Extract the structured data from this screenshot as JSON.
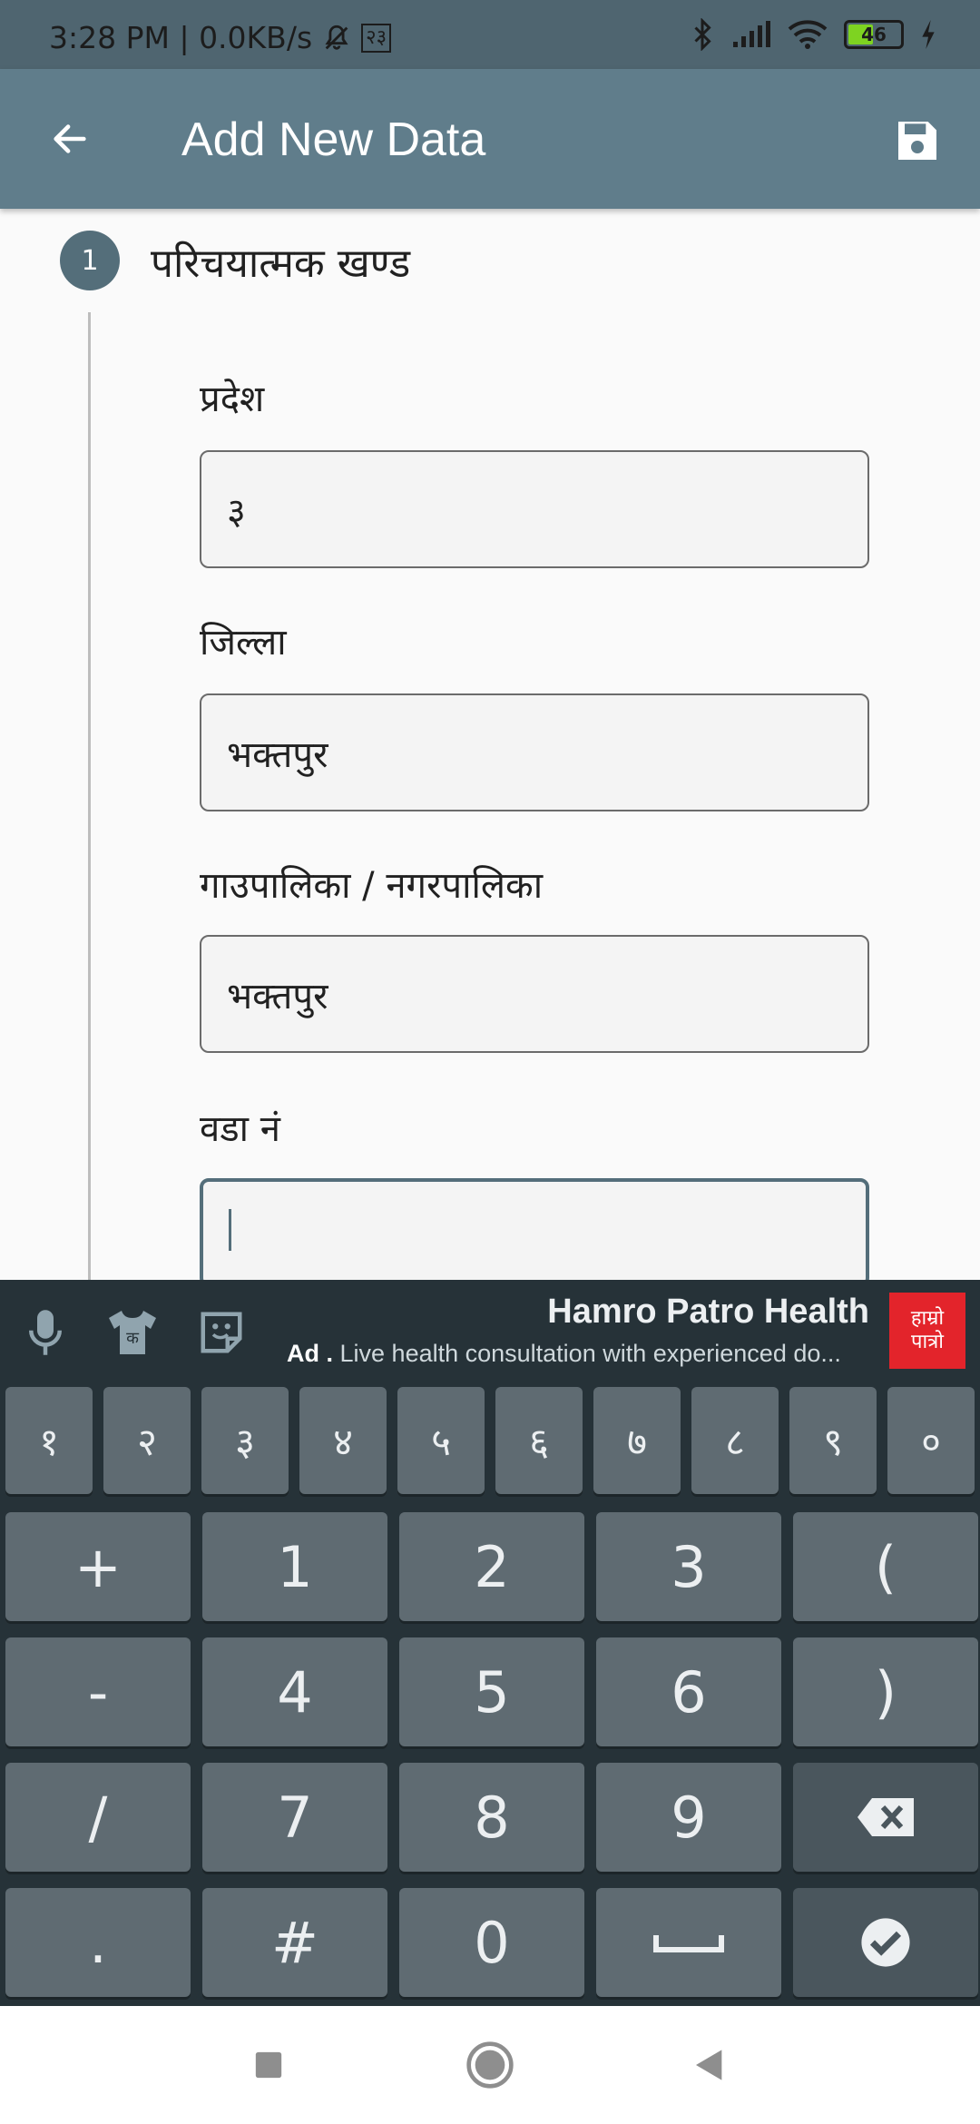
{
  "status_bar": {
    "time_speed": "3:28 PM | 0.0KB/s",
    "sim_label": "२३",
    "battery": "46"
  },
  "app_bar": {
    "title": "Add New Data"
  },
  "form": {
    "step_number": "1",
    "step_title": "परिचयात्मक खण्ड",
    "fields": [
      {
        "label": "प्रदेश",
        "value": "३"
      },
      {
        "label": "जिल्ला",
        "value": "भक्तपुर"
      },
      {
        "label": "गाउपालिका / नगरपालिका",
        "value": "भक्तपुर"
      },
      {
        "label": "वडा नं",
        "value": ""
      }
    ]
  },
  "keyboard": {
    "shirt_label": "क",
    "ad": {
      "title": "Hamro Patro Health",
      "prefix": "Ad .",
      "description": "Live health consultation with experienced do...",
      "logo_line1": "हाम्रो",
      "logo_line2": "पात्रो"
    },
    "digit_row": [
      "१",
      "२",
      "३",
      "४",
      "५",
      "६",
      "७",
      "८",
      "९",
      "०"
    ],
    "rows": [
      [
        "+",
        "1",
        "2",
        "3",
        "("
      ],
      [
        "-",
        "4",
        "5",
        "6",
        ")"
      ],
      [
        "/",
        "7",
        "8",
        "9",
        ""
      ],
      [
        ".",
        "#",
        "0",
        "",
        ""
      ]
    ]
  }
}
